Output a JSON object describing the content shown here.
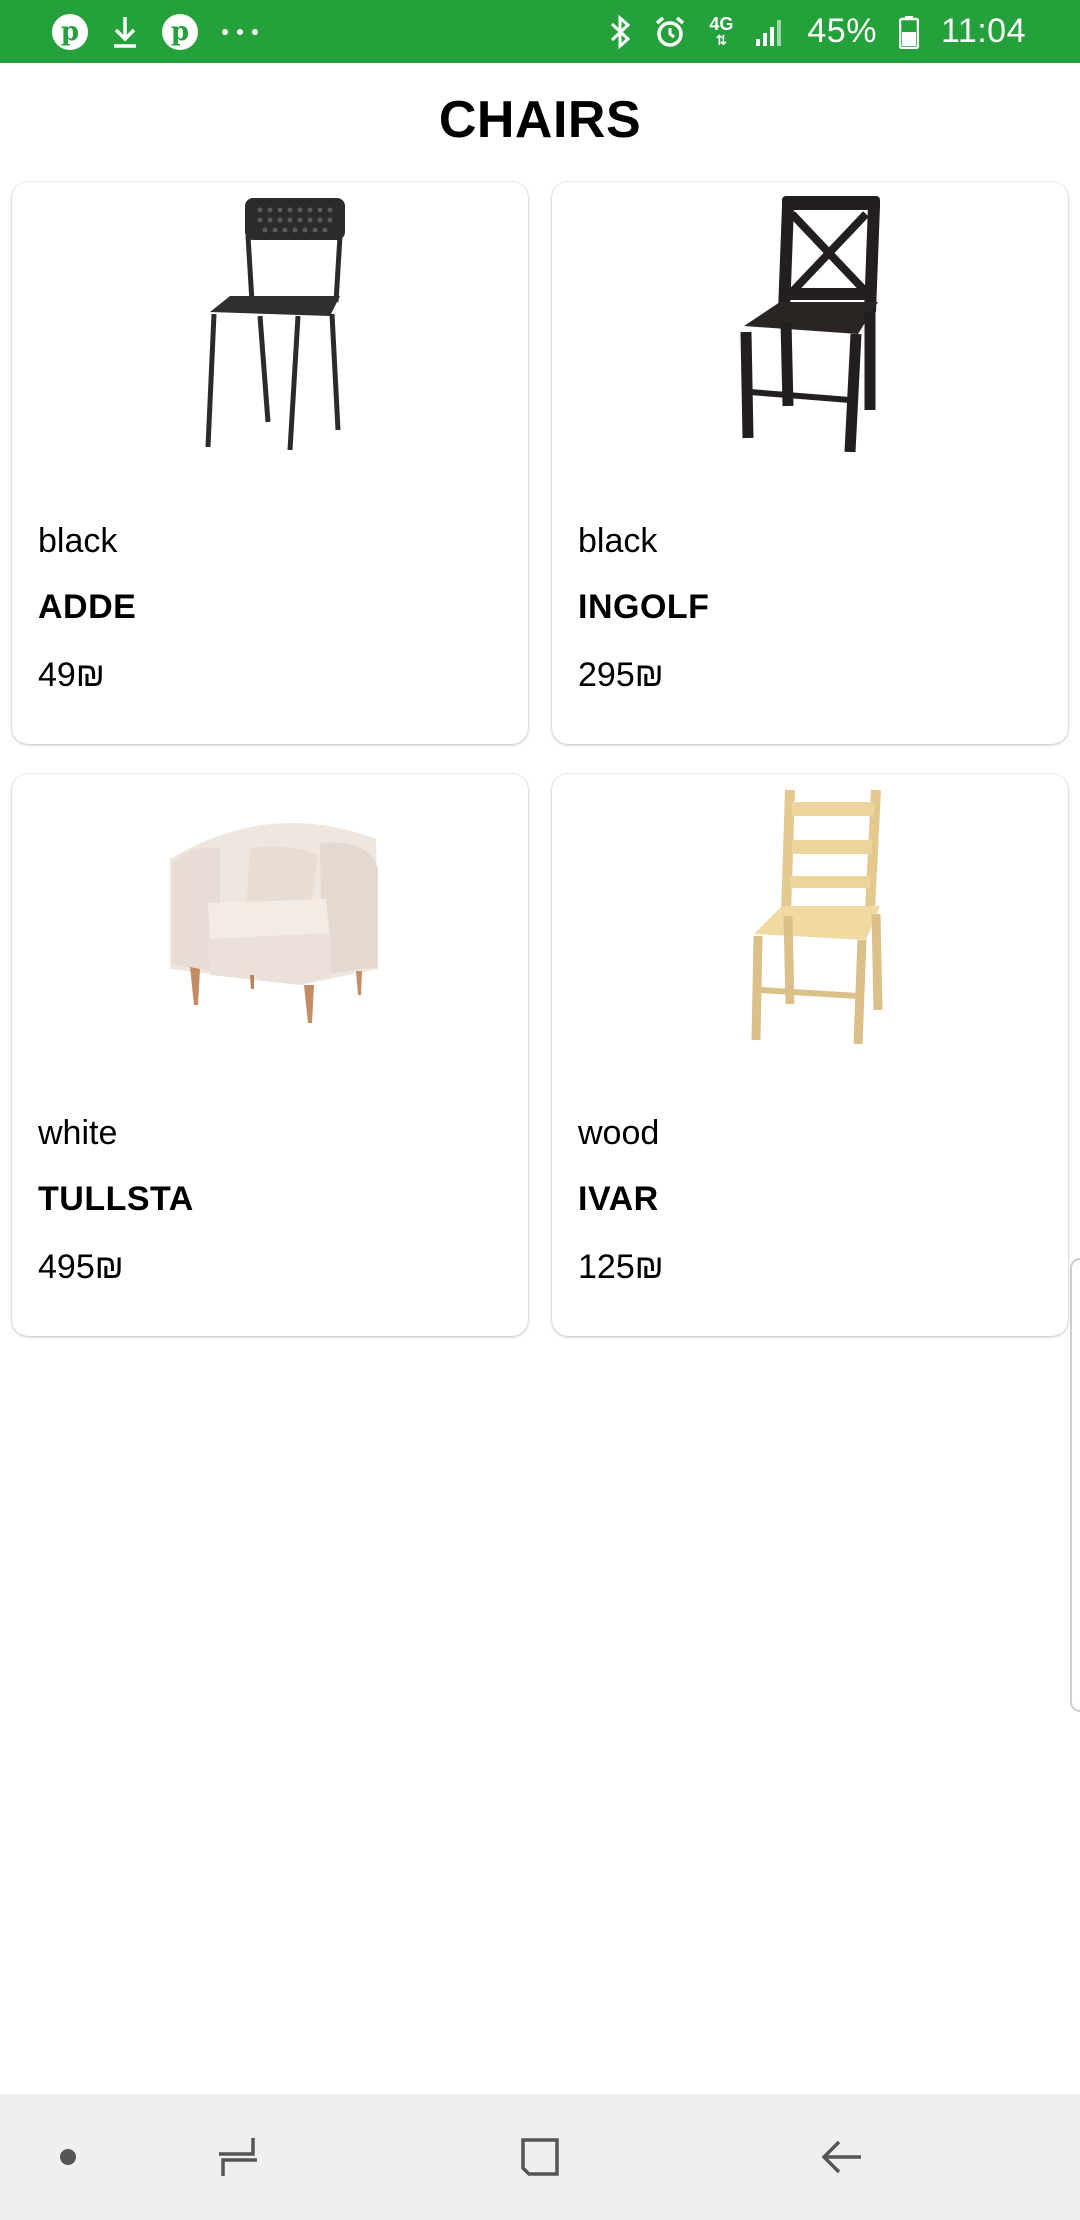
{
  "status_bar": {
    "battery": "45%",
    "time": "11:04",
    "network": "4G",
    "icons": [
      "pinterest-icon",
      "download-icon",
      "pinterest-icon",
      "more-icon",
      "bluetooth-icon",
      "alarm-icon",
      "network-4g-icon",
      "signal-icon",
      "battery-icon"
    ]
  },
  "header": {
    "title": "CHAIRS"
  },
  "products": [
    {
      "color": "black",
      "name": "ADDE",
      "price": "49₪",
      "image": "chair-adde-icon"
    },
    {
      "color": "black",
      "name": "INGOLF",
      "price": "295₪",
      "image": "chair-ingolf-icon"
    },
    {
      "color": "white",
      "name": "TULLSTA",
      "price": "495₪",
      "image": "armchair-tullsta-icon"
    },
    {
      "color": "wood",
      "name": "IVAR",
      "price": "125₪",
      "image": "chair-ivar-icon"
    }
  ],
  "nav_bar": {
    "buttons": [
      "dot-icon",
      "recents-icon",
      "home-icon",
      "back-icon"
    ]
  },
  "colors": {
    "status_bar": "#24a13a",
    "nav_bar": "#efefef",
    "background": "#ffffff"
  }
}
